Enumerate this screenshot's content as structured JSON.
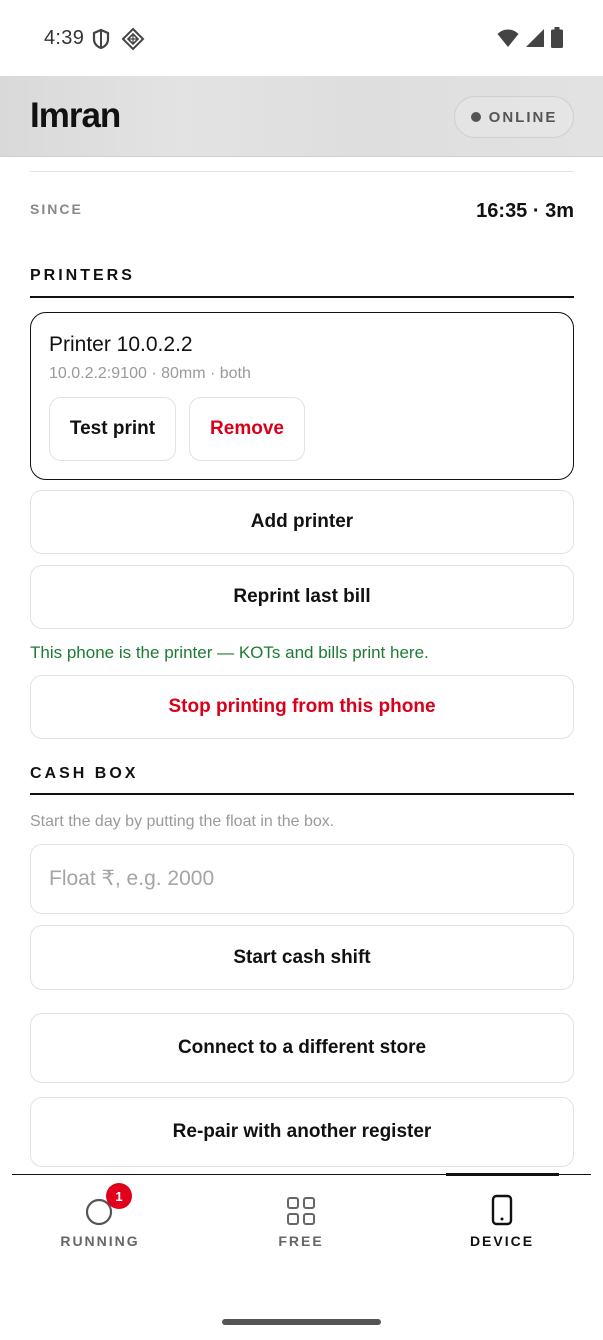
{
  "status_bar": {
    "time": "4:39",
    "left_icons": [
      "shield-icon",
      "diamond-icon"
    ],
    "right_icons": [
      "wifi-icon",
      "signal-icon",
      "battery-icon"
    ]
  },
  "header": {
    "title": "Imran",
    "status": "ONLINE"
  },
  "since": {
    "label": "SINCE",
    "value": "16:35 · 3m"
  },
  "printers": {
    "title": "PRINTERS",
    "items": [
      {
        "name": "Printer 10.0.2.2",
        "meta": "10.0.2.2:9100 · 80mm · both",
        "test_label": "Test print",
        "remove_label": "Remove"
      }
    ],
    "add_label": "Add printer",
    "reprint_label": "Reprint last bill",
    "phone_note": "This phone is the printer — KOTs and bills print here.",
    "stop_label": "Stop printing from this phone"
  },
  "cash_box": {
    "title": "CASH BOX",
    "hint": "Start the day by putting the float in the box.",
    "float_placeholder": "Float ₹, e.g. 2000",
    "start_label": "Start cash shift"
  },
  "store": {
    "connect_label": "Connect to a different store",
    "repair_label": "Re-pair with another register"
  },
  "bottom_nav": {
    "items": [
      {
        "label": "RUNNING",
        "icon": "circle-icon",
        "badge": "1",
        "active": false
      },
      {
        "label": "FREE",
        "icon": "grid-icon",
        "active": false
      },
      {
        "label": "DEVICE",
        "icon": "phone-icon",
        "active": true
      }
    ]
  },
  "colors": {
    "accent_red": "#d9001b",
    "success_green": "#1e7b34",
    "badge_red": "#e0001b",
    "header_bg": "#dedede"
  }
}
